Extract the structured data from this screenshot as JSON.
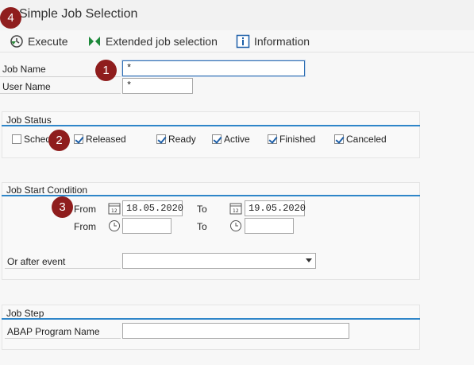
{
  "window": {
    "title": "Simple Job Selection"
  },
  "toolbar": {
    "execute_label": "Execute",
    "extended_label": "Extended job selection",
    "information_label": "Information"
  },
  "fields": {
    "job_name_label": "Job Name",
    "job_name_value": "*",
    "user_name_label": "User Name",
    "user_name_value": "*"
  },
  "job_status": {
    "title": "Job Status",
    "items": [
      {
        "label": "Scheduled",
        "checked": false
      },
      {
        "label": "Released",
        "checked": true
      },
      {
        "label": "Ready",
        "checked": true
      },
      {
        "label": "Active",
        "checked": true
      },
      {
        "label": "Finished",
        "checked": true
      },
      {
        "label": "Canceled",
        "checked": true
      }
    ]
  },
  "start_condition": {
    "title": "Job Start Condition",
    "from_label": "From",
    "to_label": "To",
    "from_date": "18.05.2020",
    "to_date": "19.05.2020",
    "from_time": "",
    "to_time": "",
    "event_label": "Or after event",
    "event_value": ""
  },
  "job_step": {
    "title": "Job Step",
    "program_label": "ABAP Program Name",
    "program_value": ""
  },
  "badges": [
    "1",
    "2",
    "3",
    "4"
  ],
  "colors": {
    "accent": "#2f86c9",
    "badge": "#8f1d1d",
    "check": "#1d5fa8"
  }
}
